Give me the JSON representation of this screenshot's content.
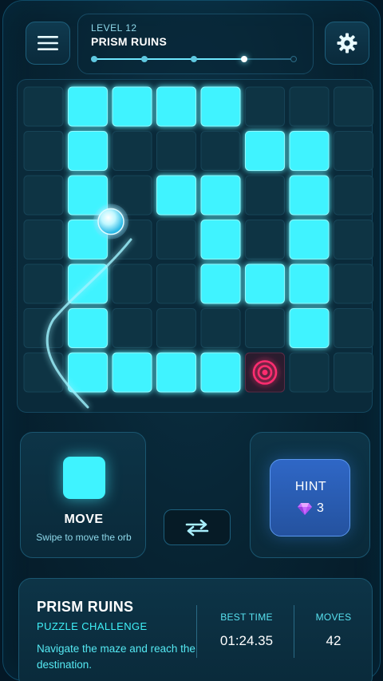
{
  "header": {
    "menu_icon": "hamburger-menu-icon",
    "settings_icon": "gear-icon",
    "level_label": "LEVEL 12",
    "level_name": "PRISM RUINS",
    "progress": {
      "total_stages": 5,
      "current_stage": 4
    }
  },
  "board": {
    "cols": 8,
    "rows": 7,
    "lit_cells": [
      [
        0,
        1
      ],
      [
        0,
        2
      ],
      [
        0,
        3
      ],
      [
        0,
        4
      ],
      [
        1,
        1
      ],
      [
        1,
        5
      ],
      [
        1,
        6
      ],
      [
        2,
        1
      ],
      [
        2,
        3
      ],
      [
        2,
        4
      ],
      [
        2,
        6
      ],
      [
        3,
        1
      ],
      [
        3,
        4
      ],
      [
        3,
        6
      ],
      [
        3,
        1
      ],
      [
        4,
        1
      ],
      [
        4,
        4
      ],
      [
        4,
        5
      ],
      [
        4,
        6
      ],
      [
        5,
        1
      ],
      [
        5,
        6
      ],
      [
        6,
        1
      ],
      [
        6,
        2
      ],
      [
        6,
        3
      ],
      [
        6,
        4
      ]
    ],
    "orb_cell": [
      3,
      2
    ],
    "target_cell": [
      6,
      5
    ],
    "colors": {
      "lit": "#3ff3ff",
      "dark": "#0e3444",
      "target": "#ff2d6f"
    }
  },
  "controls": {
    "move_label": "MOVE",
    "move_hint": "Swipe to move the orb",
    "swap_icon": "swap-arrows-icon",
    "hint_label": "HINT",
    "hint_icon": "gem-icon",
    "hint_count": "3"
  },
  "info": {
    "title": "PRISM RUINS",
    "subtitle": "PUZZLE CHALLENGE",
    "description": "Navigate the maze and reach the destination.",
    "best_time_label": "BEST TIME",
    "best_time_value": "01:24.35",
    "moves_label": "MOVES",
    "moves_value": "42"
  }
}
